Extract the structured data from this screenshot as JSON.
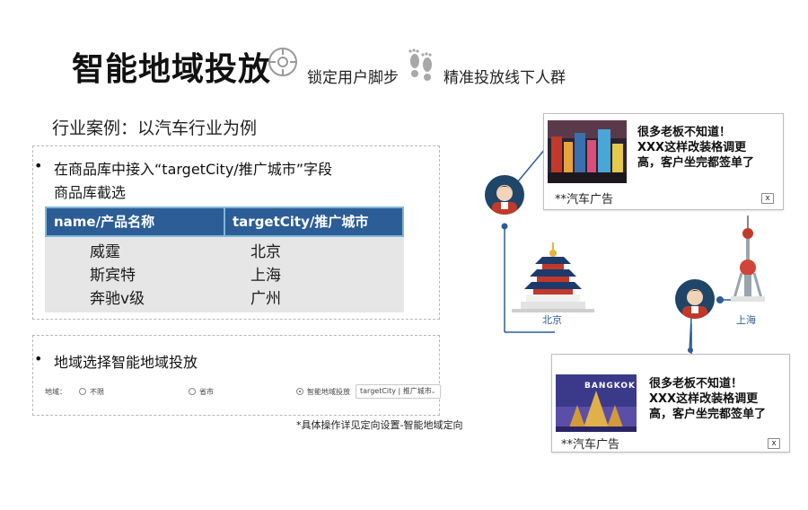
{
  "header": {
    "title": "智能地域投放",
    "lock_label": "锁定用户脚步",
    "target_label": "精准投放线下人群",
    "icons": [
      "crosshair-icon",
      "footprints-icon"
    ]
  },
  "case_title": "行业案例：以汽车行业为例",
  "section1": {
    "bullet_line1": "在商品库中接入“targetCity/推广城市”字段",
    "bullet_line2": "商品库截选",
    "table": {
      "headers": [
        "name/产品名称",
        "targetCity/推广城市"
      ],
      "rows": [
        [
          "威霆",
          "北京"
        ],
        [
          "斯宾特",
          "上海"
        ],
        [
          "奔驰v级",
          "广州"
        ]
      ]
    }
  },
  "section2": {
    "bullet": "地域选择智能地域投放",
    "region_label": "地域：",
    "options": [
      "不限",
      "省市",
      "智能地域投放"
    ],
    "selected_option": "智能地域投放",
    "select_value": "targetCity | 推广城市"
  },
  "note": "具体操作详见定向设置-智能地域定向",
  "ads": [
    {
      "text_line1": "很多老板不知道！",
      "text_line2": "XXX这样改装格调更",
      "text_line3": "高，客户坐完都签单了",
      "label": "**汽车广告",
      "close": "x"
    },
    {
      "image_caption": "BANGKOK",
      "text_line1": "很多老板不知道！",
      "text_line2": "XXX这样改装格调更",
      "text_line3": "高，客户坐完都签单了",
      "label": "**汽车广告",
      "close": "x"
    }
  ],
  "cities": {
    "beijing": "北京",
    "shanghai": "上海"
  },
  "colors": {
    "table_header": "#2c5d96",
    "table_body": "#e6e6e6",
    "avatar_bg": "#1f4568",
    "city_label": "#2c5d96"
  }
}
